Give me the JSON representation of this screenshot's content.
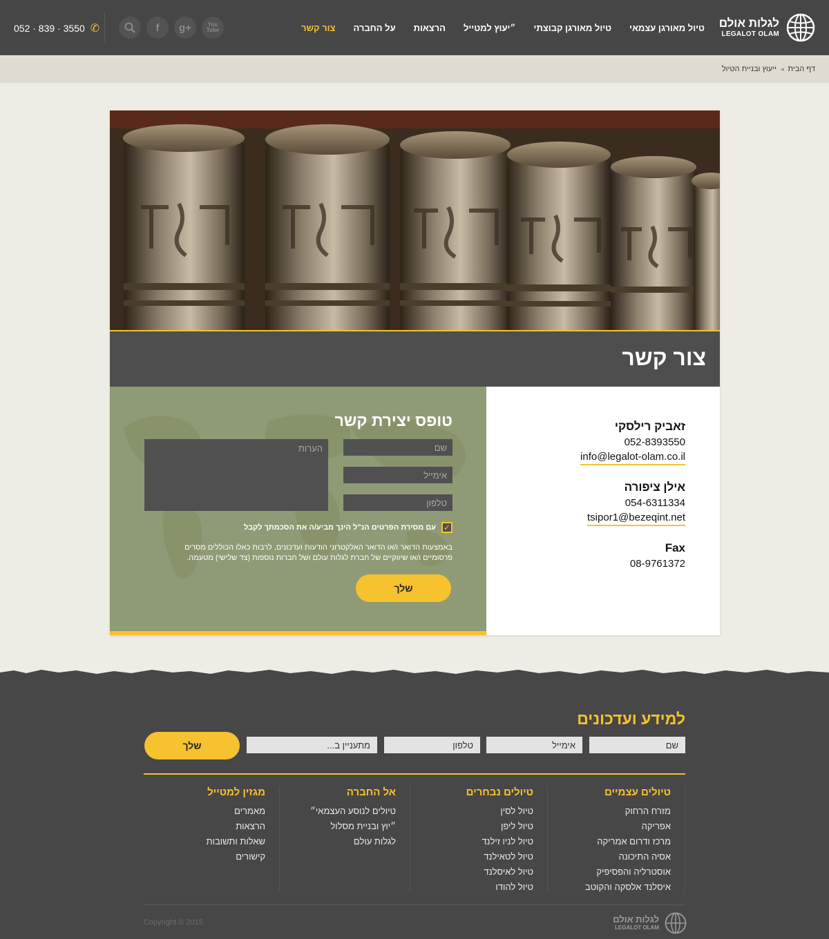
{
  "header": {
    "logo_he": "לגלות אולם",
    "logo_en": "LEGALOT OLAM",
    "nav": [
      {
        "label": "טיול מאורגן עצמאי",
        "active": false
      },
      {
        "label": "טיול מאורגן קבוצתי",
        "active": false
      },
      {
        "label": "״יעוץ למטייל",
        "active": false
      },
      {
        "label": "הרצאות",
        "active": false
      },
      {
        "label": "על החברה",
        "active": false
      },
      {
        "label": "צור קשר",
        "active": true
      }
    ],
    "socials": [
      "youtube-icon",
      "google-plus-icon",
      "facebook-icon",
      "search-icon"
    ],
    "phone": "052 · 839 · 3550"
  },
  "breadcrumb": [
    "דף הבית",
    "ייעוץ ובניית הטיול"
  ],
  "page_title": "צור קשר",
  "contacts": [
    {
      "name": "זאביק רילסקי",
      "phone": "052-8393550",
      "email": "info@legalot-olam.co.il"
    },
    {
      "name": "אילן ציפורה",
      "phone": "054-6311334",
      "email": "tsipor1@bezeqint.net"
    },
    {
      "name": "Fax",
      "phone": "08-9761372",
      "email": ""
    }
  ],
  "form": {
    "title": "טופס יצירת קשר",
    "name_placeholder": "שם",
    "email_placeholder": "אימייל",
    "phone_placeholder": "טלפון",
    "notes_placeholder": "הערות",
    "consent": "עם מסירת הפרטים הנ\"ל הינך מביע/ה את הסכמתך לקבל",
    "disclaimer": "באמצעות הדואר ו/או הדואר האלקטרוני הודעות ועדכונים, לרבות כאלו הכוללים מסרים פרסומיים ו/או שיווקיים של חברת לגלות עולם ושל חברות נוספות (צד שלישי) מטעמה.",
    "send": "שלך"
  },
  "newsletter": {
    "title": "למידע ועדכונים",
    "name_placeholder": "שם",
    "email_placeholder": "אימייל",
    "phone_placeholder": "טלפון",
    "interest_placeholder": "מתעניין ב...",
    "send": "שלך"
  },
  "footer_columns": [
    {
      "title": "טיולים עצמיים",
      "items": [
        "מזרח הרחוק",
        "אפריקה",
        "מרכז ודרום אמריקה",
        "אסיה התיכונה",
        "אוסטרליה והפסיפיק",
        "איסלנד אלסקה והקוטב"
      ]
    },
    {
      "title": "טיולים נבחרים",
      "items": [
        "טיול לסין",
        "טיול ליפן",
        "טיול לניו זילנד",
        "טיול לטאילנד",
        "טיול לאיסלנד",
        "טיול להודו"
      ]
    },
    {
      "title": "אל החברה",
      "items": [
        "טיולים לנוסע העצמאי״",
        "״יוץ ובניית מסלול",
        "לגלות עולם"
      ]
    },
    {
      "title": "מגזין למטייל",
      "items": [
        "מאמרים",
        "הרצאות",
        "שאלות ותשובות",
        "קישורים"
      ]
    }
  ],
  "footer_logo_he": "לגלות אולם",
  "footer_logo_en": "LEGALOT OLAM",
  "copyright": "Copyright © 2015",
  "colors": {
    "accent": "#f7c22f",
    "header": "#464646",
    "form_bg": "#8f9b76",
    "page_bg": "#eeede5"
  }
}
